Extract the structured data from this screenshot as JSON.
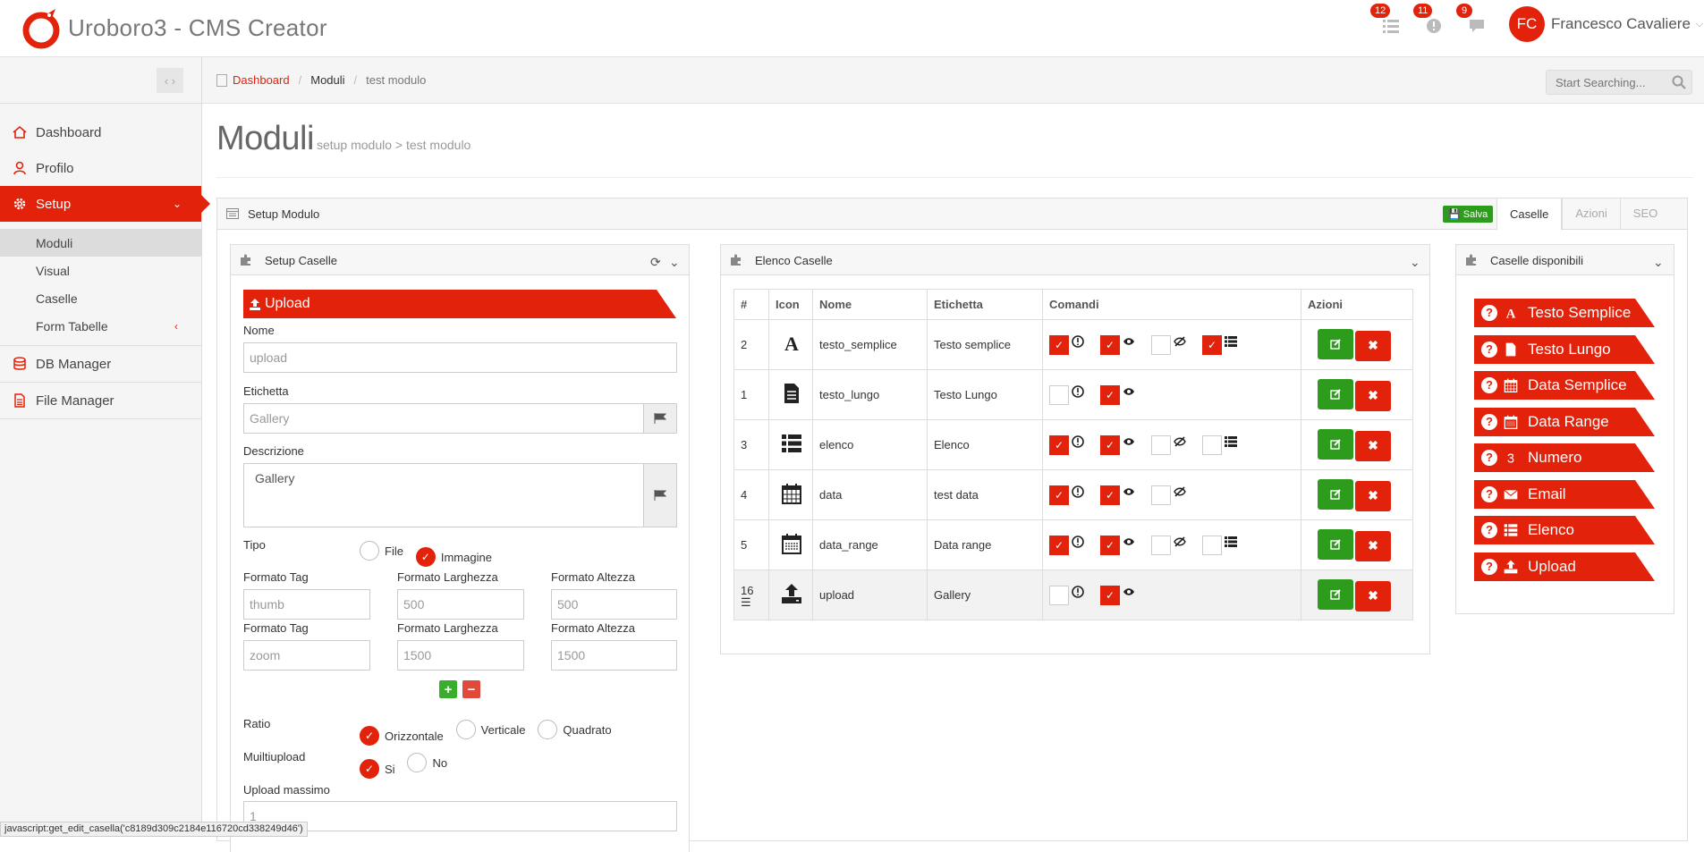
{
  "app": {
    "title": "Uroboro3 - CMS Creator"
  },
  "notifications": [
    {
      "icon": "tasks-icon",
      "count": "12"
    },
    {
      "icon": "alert-icon",
      "count": "11"
    },
    {
      "icon": "comments-icon",
      "count": "9"
    }
  ],
  "user": {
    "initials": "FC",
    "name": "Francesco Cavaliere"
  },
  "sidebar": {
    "items": [
      {
        "label": "Dashboard",
        "icon": "home-icon"
      },
      {
        "label": "Profilo",
        "icon": "user-icon"
      },
      {
        "label": "Setup",
        "icon": "gear-icon"
      },
      {
        "label": "DB Manager",
        "icon": "database-icon"
      },
      {
        "label": "File Manager",
        "icon": "file-icon"
      }
    ],
    "sub_items": [
      "Moduli",
      "Visual",
      "Caselle",
      "Form Tabelle"
    ]
  },
  "breadcrumb": {
    "items": [
      "Dashboard",
      "Moduli",
      "test modulo"
    ]
  },
  "search": {
    "placeholder": "Start Searching..."
  },
  "page": {
    "title": "Moduli",
    "subtitle": "setup modulo > test modulo"
  },
  "setup_modulo": {
    "title": "Setup Modulo",
    "save_label": "Salva",
    "tabs": [
      "Caselle",
      "Azioni",
      "SEO"
    ]
  },
  "setup_caselle": {
    "title": "Setup Caselle",
    "ribbon": "Upload",
    "nome_label": "Nome",
    "nome_value": "upload",
    "etichetta_label": "Etichetta",
    "etichetta_value": "Gallery",
    "descrizione_label": "Descrizione",
    "descrizione_value": "Gallery",
    "tipo_label": "Tipo",
    "tipo_options": [
      "File",
      "Immagine"
    ],
    "formati": [
      {
        "tag_label": "Formato Tag",
        "tag": "thumb",
        "w_label": "Formato Larghezza",
        "w": "500",
        "h_label": "Formato Altezza",
        "h": "500"
      },
      {
        "tag_label": "Formato Tag",
        "tag": "zoom",
        "w_label": "Formato Larghezza",
        "w": "1500",
        "h_label": "Formato Altezza",
        "h": "1500"
      }
    ],
    "ratio_label": "Ratio",
    "ratio_options": [
      "Orizzontale",
      "Verticale",
      "Quadrato"
    ],
    "multiupload_label": "Muiltiupload",
    "multiupload_options": [
      "Si",
      "No"
    ],
    "upload_max_label": "Upload massimo",
    "upload_max_value": "1"
  },
  "elenco_caselle": {
    "title": "Elenco Caselle",
    "columns": [
      "#",
      "Icon",
      "Nome",
      "Etichetta",
      "Comandi",
      "Azioni"
    ],
    "rows": [
      {
        "num": "2",
        "icon": "font-icon",
        "nome": "testo_semplice",
        "etichetta": "Testo semplice",
        "cmd": [
          true,
          true,
          false,
          true
        ],
        "cols": 4
      },
      {
        "num": "1",
        "icon": "file-text-icon",
        "nome": "testo_lungo",
        "etichetta": "Testo Lungo",
        "cmd": [
          false,
          true
        ],
        "cols": 2
      },
      {
        "num": "3",
        "icon": "list-icon",
        "nome": "elenco",
        "etichetta": "Elenco",
        "cmd": [
          true,
          true,
          false,
          false
        ],
        "cols": 4
      },
      {
        "num": "4",
        "icon": "calendar-icon",
        "nome": "data",
        "etichetta": "test data",
        "cmd": [
          true,
          true,
          false
        ],
        "cols": 3
      },
      {
        "num": "5",
        "icon": "calendar-range-icon",
        "nome": "data_range",
        "etichetta": "Data range",
        "cmd": [
          true,
          true,
          false,
          false
        ],
        "cols": 4
      },
      {
        "num": "16",
        "icon": "upload-icon",
        "nome": "upload",
        "etichetta": "Gallery",
        "cmd": [
          false,
          true
        ],
        "cols": 2
      }
    ]
  },
  "caselle_disponibili": {
    "title": "Caselle disponibili",
    "items": [
      {
        "label": "Testo Semplice",
        "icon": "font-icon"
      },
      {
        "label": "Testo Lungo",
        "icon": "file-text-icon"
      },
      {
        "label": "Data Semplice",
        "icon": "calendar-icon"
      },
      {
        "label": "Data Range",
        "icon": "calendar-range-icon"
      },
      {
        "label": "Numero",
        "icon": "number-icon"
      },
      {
        "label": "Email",
        "icon": "envelope-icon"
      },
      {
        "label": "Elenco",
        "icon": "list-icon"
      },
      {
        "label": "Upload",
        "icon": "upload-icon"
      }
    ]
  },
  "statusbar": {
    "text": "javascript:get_edit_casella('c8189d309c2184e116720cd338249d46')"
  },
  "colors": {
    "accent": "#e2220b",
    "success": "#2d9b1c"
  }
}
